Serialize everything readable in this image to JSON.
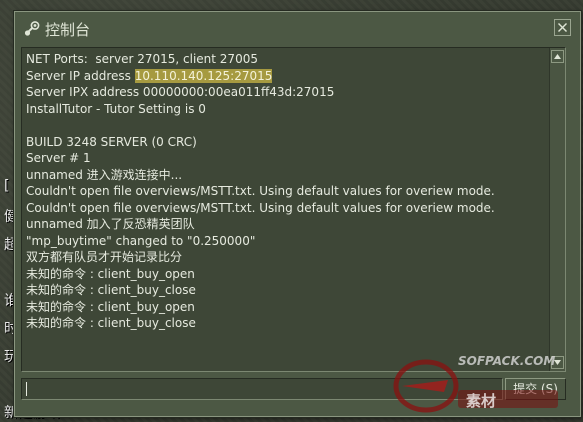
{
  "window": {
    "title": "控制台",
    "icon": "steam-icon",
    "close_icon": "close-icon"
  },
  "console": {
    "lines": [
      {
        "text": "NET Ports:  server 27015, client 27005"
      },
      {
        "prefix": "Server IP address ",
        "highlight": "10.110.140.125:27015"
      },
      {
        "text": "Server IPX address 00000000:00ea011ff43d:27015"
      },
      {
        "text": "InstallTutor - Tutor Setting is 0"
      },
      {
        "text": ""
      },
      {
        "text": "BUILD 3248 SERVER (0 CRC)"
      },
      {
        "text": "Server # 1"
      },
      {
        "text": "unnamed 进入游戏连接中..."
      },
      {
        "text": "Couldn't open file overviews/MSTT.txt. Using default values for overiew mode."
      },
      {
        "text": "Couldn't open file overviews/MSTT.txt. Using default values for overiew mode."
      },
      {
        "text": "unnamed 加入了反恐精英团队"
      },
      {
        "text": "\"mp_buytime\" changed to \"0.250000\""
      },
      {
        "text": "双方都有队员才开始记录比分"
      },
      {
        "text": "未知的命令 : client_buy_open"
      },
      {
        "text": "未知的命令 : client_buy_close"
      },
      {
        "text": "未知的命令 : client_buy_open"
      },
      {
        "text": "未知的命令 : client_buy_close"
      }
    ]
  },
  "input": {
    "value": ""
  },
  "submit": {
    "label": "提交 (S)"
  },
  "background_hud": {
    "lines": [
      "[",
      "健",
      "超",
      "",
      "谁",
      "时",
      "玩",
      "",
      "新建游戏"
    ]
  },
  "watermark": {
    "url": "SOFPACK.COM",
    "text": "素材"
  },
  "colors": {
    "window_bg": "#4c5844",
    "console_bg": "#3e4737",
    "text": "#e6eadf",
    "highlight": "#a69a40"
  }
}
